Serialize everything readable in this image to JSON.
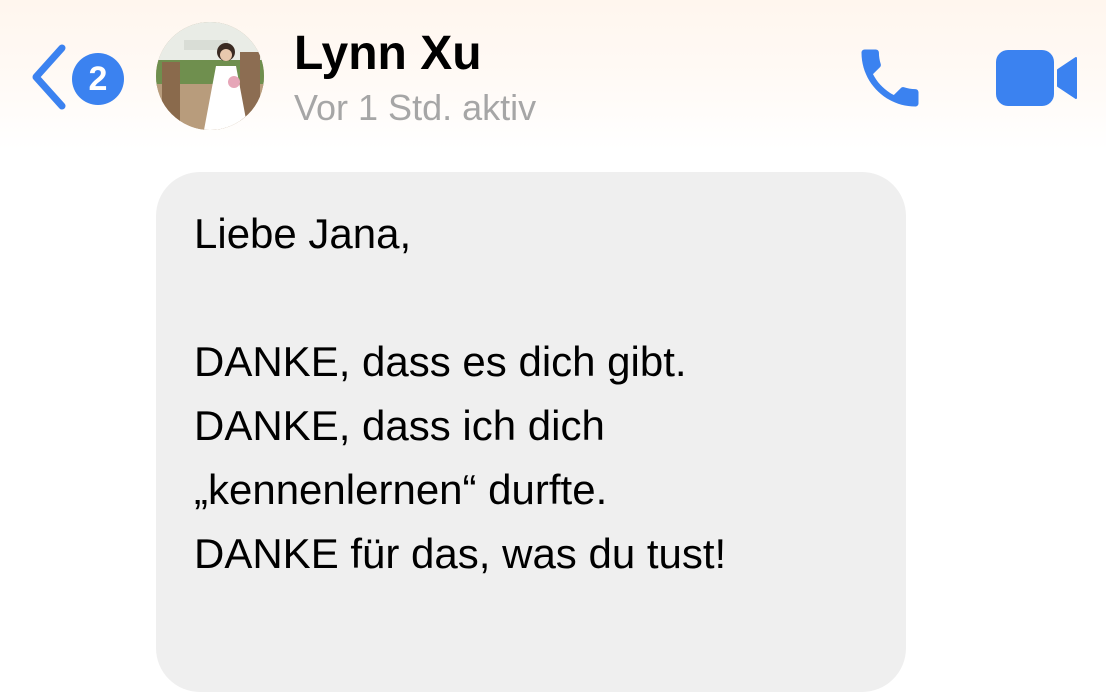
{
  "header": {
    "back_badge_count": "2",
    "contact_name": "Lynn Xu",
    "contact_status": "Vor 1 Std. aktiv",
    "icons": {
      "back": "chevron-left-icon",
      "call": "phone-icon",
      "video": "video-camera-icon"
    },
    "accent_color": "#3b82f0"
  },
  "message": {
    "lines": [
      "Liebe Jana,",
      "",
      "DANKE, dass es dich gibt.",
      "DANKE, dass ich dich",
      "„kennenlernen“ durfte.",
      "DANKE für das, was du tust!"
    ],
    "bubble_color": "#efefef"
  }
}
